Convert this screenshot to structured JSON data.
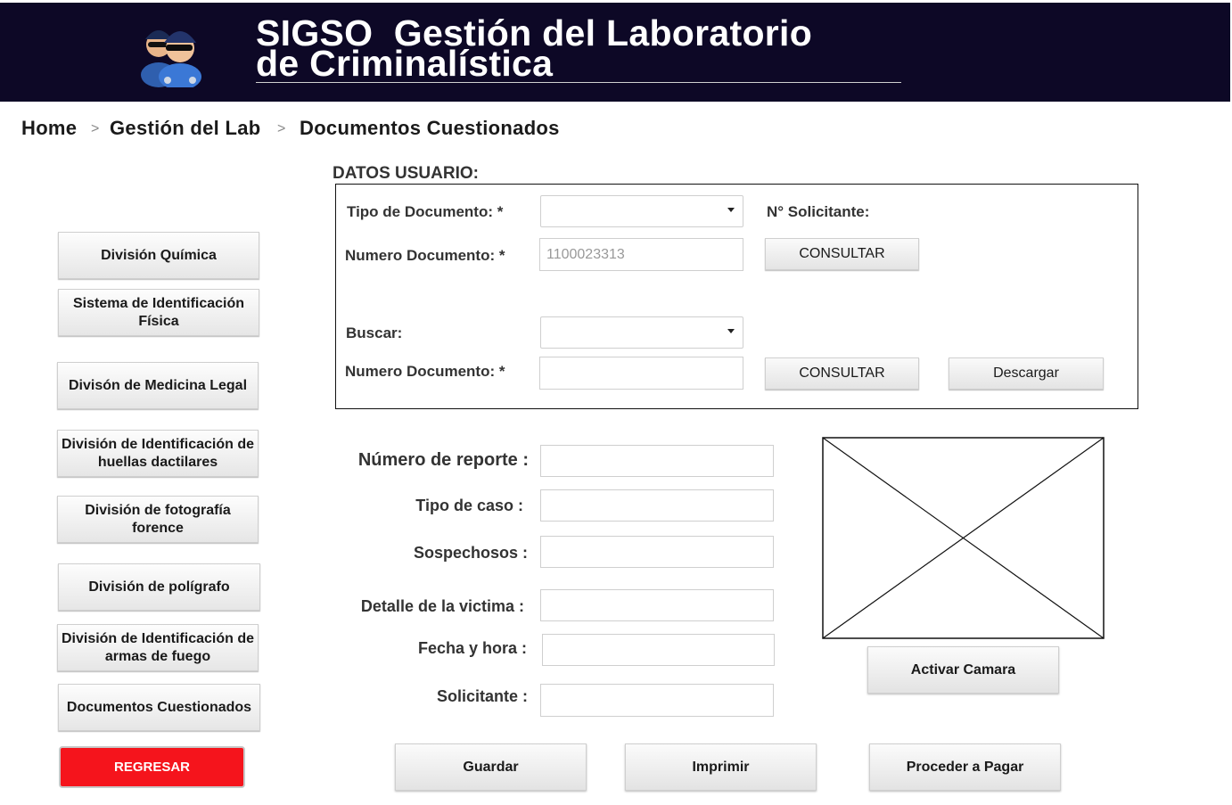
{
  "header": {
    "title_line1": "SIGSO  Gestión del Laboratorio",
    "title_line2": "de Criminalística",
    "logo_icon": "police-officer-icon"
  },
  "breadcrumb": {
    "items": [
      "Home",
      "Gestión del Lab",
      "Documentos Cuestionados"
    ],
    "separator": ">"
  },
  "sidebar": {
    "items": [
      {
        "line1": "División Química",
        "line2": ""
      },
      {
        "line1": "Sistema de Identificación",
        "line2": "Física"
      },
      {
        "line1": "Divisón de Medicina Legal",
        "line2": ""
      },
      {
        "line1": "División de Identificación de",
        "line2": "huellas dactilares"
      },
      {
        "line1": "División de fotografía",
        "line2": "forence"
      },
      {
        "line1": "División de polígrafo",
        "line2": ""
      },
      {
        "line1": "División de Identificación de",
        "line2": "armas de fuego"
      },
      {
        "line1": "Documentos Cuestionados",
        "line2": ""
      }
    ],
    "back_label": "REGRESAR"
  },
  "datos": {
    "title": "DATOS USUARIO:",
    "tipo_documento_label": "Tipo de Documento: *",
    "solicitante_label": "N° Solicitante:",
    "numero_documento_label": "Numero Documento: *",
    "numero_documento_value": "1100023313",
    "consultar_label": "CONSULTAR",
    "buscar_label": "Buscar:",
    "numero_documento2_label": "Numero Documento: *",
    "consultar2_label": "CONSULTAR",
    "descargar_label": "Descargar"
  },
  "form": {
    "numero_reporte": "Número de reporte :",
    "tipo_caso": "Tipo de caso :",
    "sospechosos": "Sospechosos :",
    "detalle_victima": "Detalle de la victima :",
    "fecha_hora": "Fecha y hora :",
    "solicitante": "Solicitante :"
  },
  "camera": {
    "activate_label": "Activar Camara"
  },
  "actions": {
    "save": "Guardar",
    "print": "Imprimir",
    "pay": "Proceder a Pagar"
  }
}
